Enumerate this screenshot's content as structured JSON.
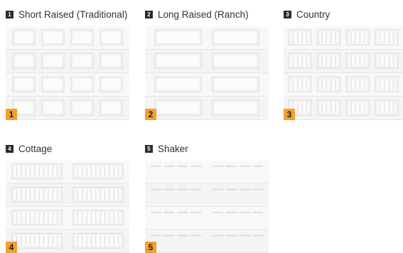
{
  "styles": [
    {
      "number": "1",
      "label": "Short Raised (Traditional)",
      "tag": "1",
      "pattern": "short-raised"
    },
    {
      "number": "2",
      "label": "Long Raised (Ranch)",
      "tag": "2",
      "pattern": "long-raised"
    },
    {
      "number": "3",
      "label": "Country",
      "tag": "3",
      "pattern": "country"
    },
    {
      "number": "4",
      "label": "Cottage",
      "tag": "4",
      "pattern": "cottage"
    },
    {
      "number": "5",
      "label": "Shaker",
      "tag": "5",
      "pattern": "shaker"
    }
  ],
  "colors": {
    "badge": "#2b2b2b",
    "tag": "#f2a12a",
    "door": "#f7f7f7",
    "line": "#d9d9d9"
  }
}
